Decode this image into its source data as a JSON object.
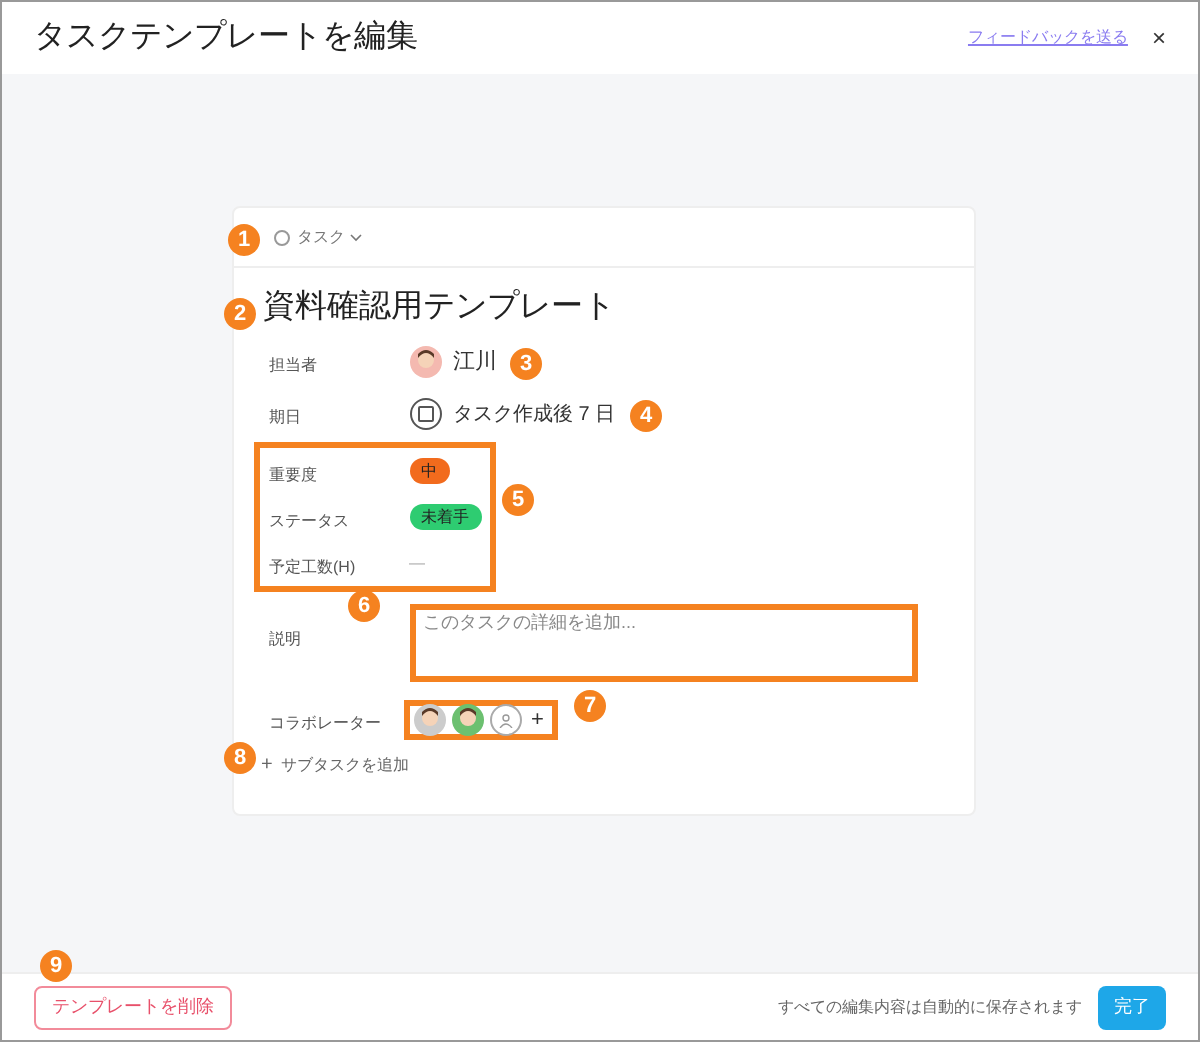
{
  "window": {
    "title": "タスクテンプレートを編集",
    "feedback_link": "フィードバックを送る",
    "close": "×"
  },
  "task": {
    "type_label": "タスク",
    "title": "資料確認用テンプレート",
    "fields": [
      {
        "kind": "person",
        "label": "担当者",
        "value": "江川"
      },
      {
        "kind": "date",
        "label": "期日",
        "value": "タスク作成後 7 日"
      },
      {
        "kind": "tag",
        "label": "重要度",
        "value": "中",
        "color": "#f26b1d"
      },
      {
        "kind": "tag",
        "label": "ステータス",
        "value": "未着手",
        "color": "#2ecc71"
      },
      {
        "kind": "text",
        "label": "予定工数(H)",
        "value": "—"
      },
      {
        "kind": "textarea",
        "label": "説明",
        "placeholder": "このタスクの詳細を追加..."
      },
      {
        "kind": "collaborators",
        "label": "コラボレーター",
        "add": "+"
      }
    ],
    "add_subtask": "サブタスクを追加",
    "add_subtask_icon": "+"
  },
  "callouts": [
    "1",
    "2",
    "3",
    "4",
    "5",
    "6",
    "7",
    "8",
    "9"
  ],
  "footer": {
    "delete_button": "テンプレートを削除",
    "note": "すべての編集内容は自動的に保存されます",
    "done_button": "完了"
  }
}
